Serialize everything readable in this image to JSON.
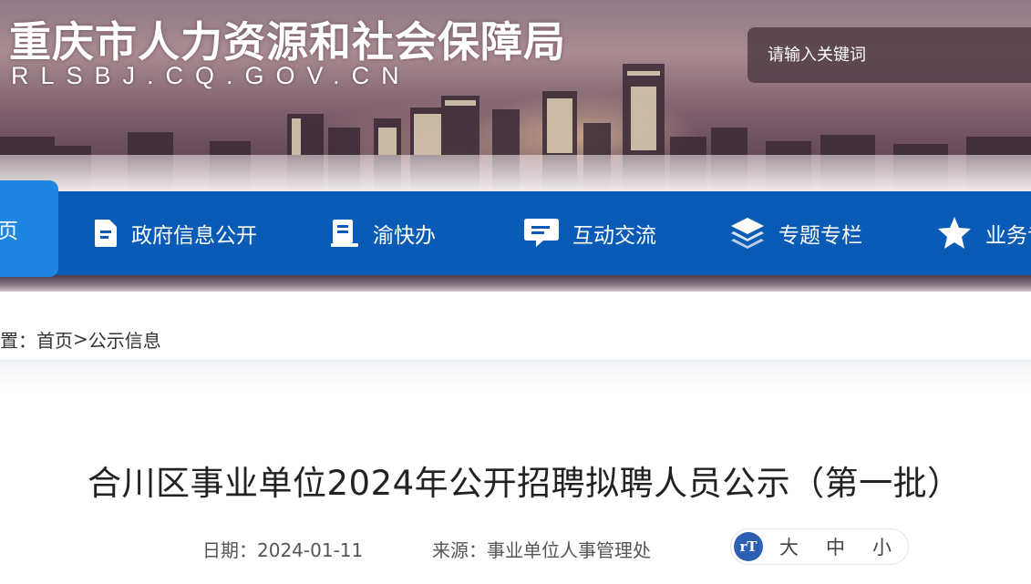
{
  "site": {
    "title": "重庆市人力资源和社会保障局",
    "domain": "RLSBJ.CQ.GOV.CN"
  },
  "search": {
    "placeholder": "请输入关键词"
  },
  "nav": {
    "home": "页",
    "items": [
      {
        "label": "政府信息公开",
        "icon": "document-icon"
      },
      {
        "label": "渝快办",
        "icon": "ledger-icon"
      },
      {
        "label": "互动交流",
        "icon": "chat-icon"
      },
      {
        "label": "专题专栏",
        "icon": "layers-icon"
      },
      {
        "label": "业务专",
        "icon": "star-icon"
      }
    ]
  },
  "breadcrumb": {
    "prefix": "置：",
    "home": "首页",
    "separator": ">",
    "current": "公示信息"
  },
  "article": {
    "title": "合川区事业单位2024年公开招聘拟聘人员公示（第一批）",
    "date_label": "日期：",
    "date": "2024-01-11",
    "source_label": "来源：",
    "source": "事业单位人事管理处"
  },
  "font_size": {
    "icon_text": "rT",
    "large": "大",
    "medium": "中",
    "small": "小"
  },
  "colors": {
    "nav_bg": "#0a5bb5",
    "nav_active": "#1e86e0",
    "font_icon_bg": "#2d5fb3"
  }
}
